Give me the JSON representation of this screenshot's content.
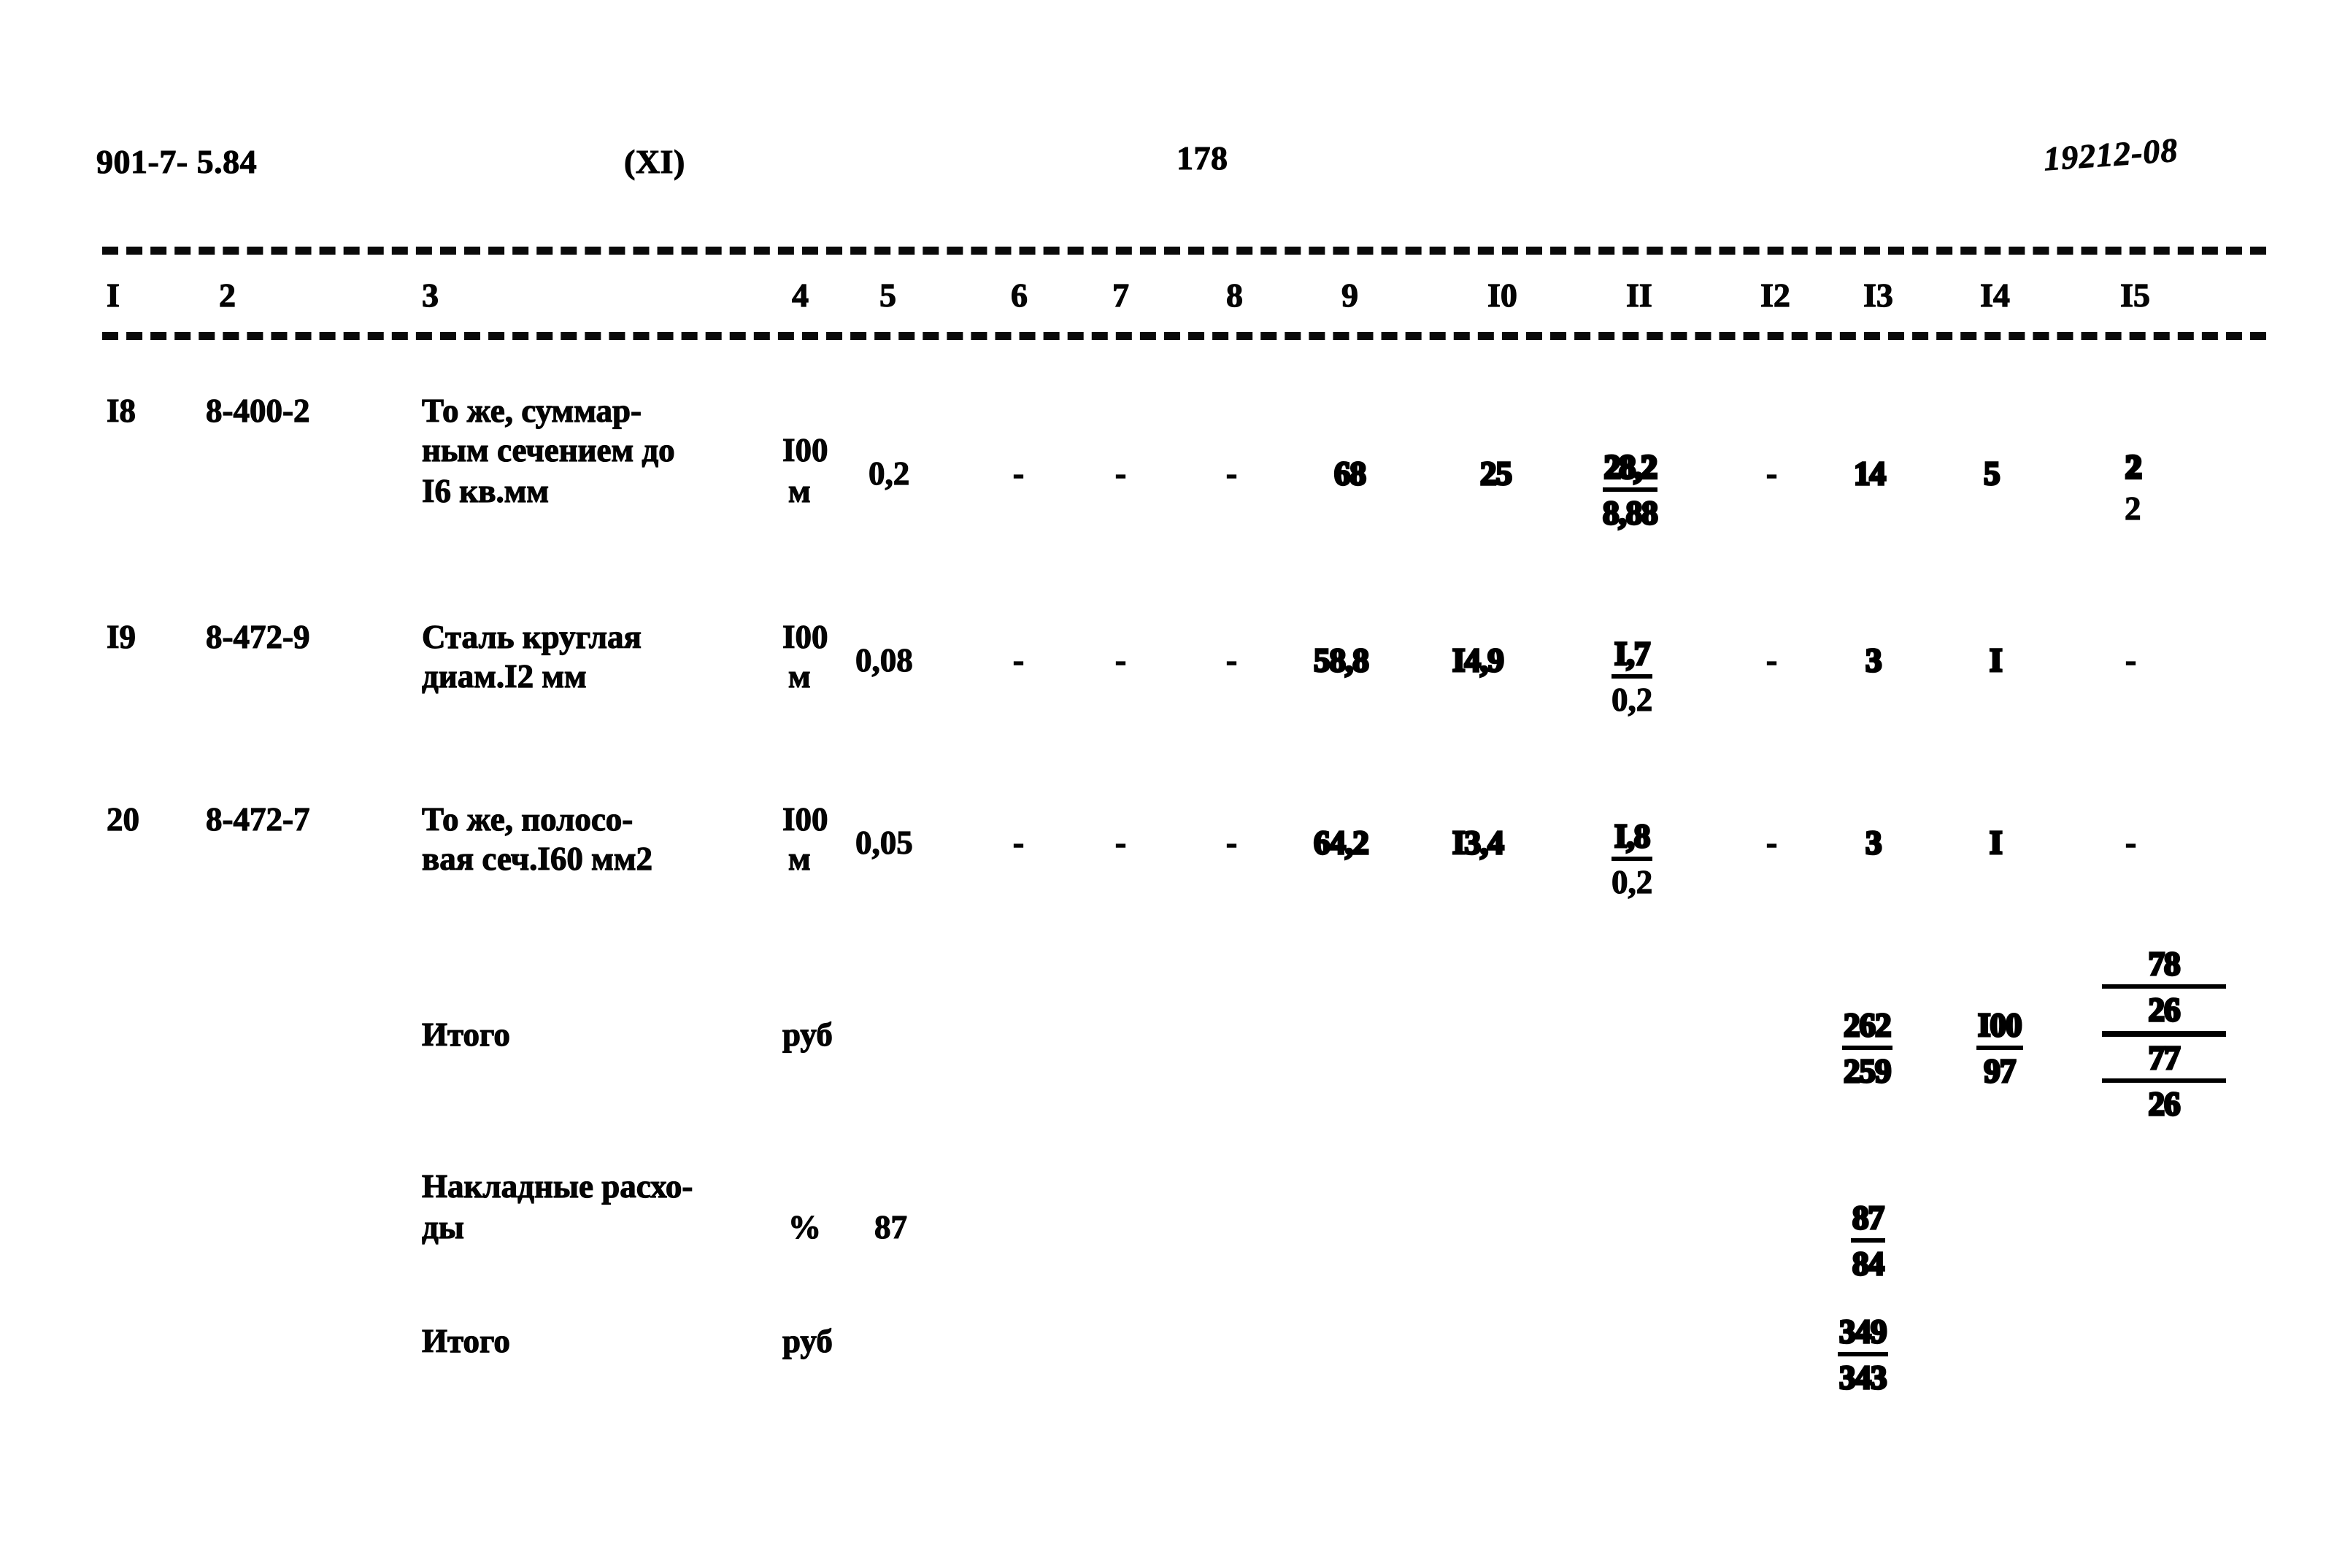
{
  "header": {
    "doc_code": "901-7- 5.84",
    "part": "(XI)",
    "page_number": "178",
    "archive_number": "19212-08"
  },
  "table": {
    "column_headers": [
      "I",
      "2",
      "3",
      "4",
      "5",
      "6",
      "7",
      "8",
      "9",
      "I0",
      "II",
      "I2",
      "I3",
      "I4",
      "I5"
    ],
    "rows": [
      {
        "num": "I8",
        "code": "8-400-2",
        "desc_line1": "То же, суммар-",
        "desc_line2": "ным сечением до",
        "desc_line3": "I6 кв.мм",
        "unit_line1": "I00",
        "unit_line2": "м",
        "c5": "0,2",
        "c6": "-",
        "c7": "-",
        "c8": "-",
        "c9": "68",
        "c10": "25",
        "c11_num": "28,2",
        "c11_den": "8,88",
        "c12": "-",
        "c13": "14",
        "c14": "5",
        "c15_num": "2",
        "c15_den": "2"
      },
      {
        "num": "I9",
        "code": "8-472-9",
        "desc_line1": "Сталь круглая",
        "desc_line2": "диам.I2 мм",
        "desc_line3": "",
        "unit_line1": "I00",
        "unit_line2": "м",
        "c5": "0,08",
        "c6": "-",
        "c7": "-",
        "c8": "-",
        "c9": "58,8",
        "c10": "I4,9",
        "c11_num": "I,7",
        "c11_den": "0,2",
        "c12": "-",
        "c13": "3",
        "c14": "I",
        "c15": "-"
      },
      {
        "num": "20",
        "code": "8-472-7",
        "desc_line1": "То же, полосо-",
        "desc_line2": "вая сеч.I60 мм2",
        "desc_line3": "",
        "unit_line1": "I00",
        "unit_line2": "м",
        "c5": "0,05",
        "c6": "-",
        "c7": "-",
        "c8": "-",
        "c9": "64,2",
        "c10": "I3,4",
        "c11_num": "I,8",
        "c11_den": "0,2",
        "c12": "-",
        "c13": "3",
        "c14": "I",
        "c15": "-"
      }
    ],
    "summary_rows": [
      {
        "label": "Итого",
        "unit": "руб",
        "value": "",
        "c13_num": "262",
        "c13_den": "259",
        "c14_num": "I00",
        "c14_den": "97",
        "c15_l1": "78",
        "c15_l2": "26",
        "c15_l3": "77",
        "c15_l4": "26"
      },
      {
        "label_line1": "Накладные расхо-",
        "label_line2": "ды",
        "unit": "%",
        "value": "87",
        "c13_num": "87",
        "c13_den": "84"
      },
      {
        "label": "Итого",
        "unit": "руб",
        "value": "",
        "c13_num": "349",
        "c13_den": "343"
      }
    ]
  }
}
